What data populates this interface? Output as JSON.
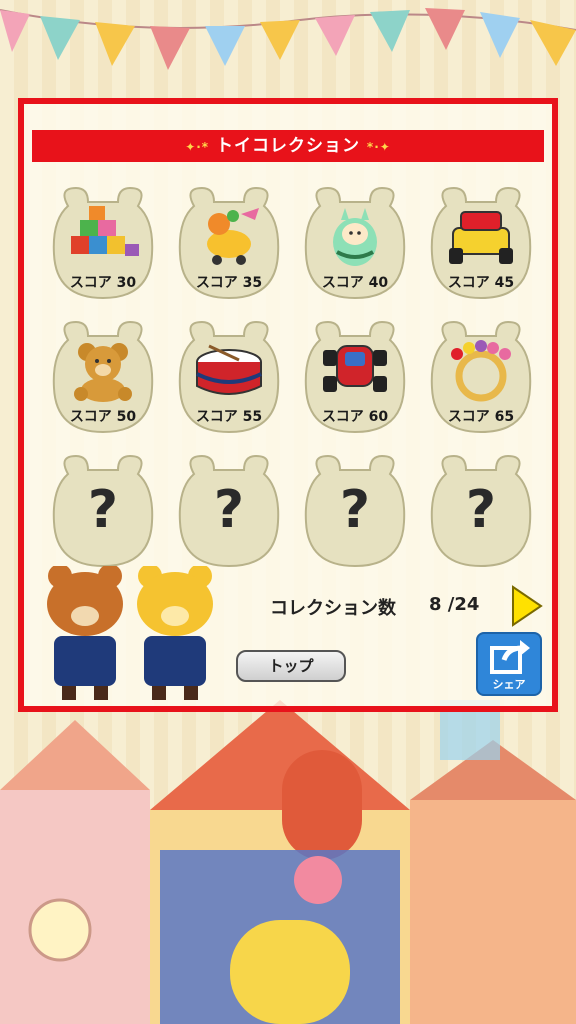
{
  "panel": {
    "title": "トイコレクション",
    "title_spark_left": "✦·*",
    "title_spark_right": "*·✦"
  },
  "toys": [
    {
      "name": "building-blocks",
      "score_label": "スコア 30",
      "unlocked": true
    },
    {
      "name": "duck-pull-toy",
      "score_label": "スコア 35",
      "unlocked": true
    },
    {
      "name": "roly-poly-doll",
      "score_label": "スコア 40",
      "unlocked": true
    },
    {
      "name": "yellow-car",
      "score_label": "スコア 45",
      "unlocked": true
    },
    {
      "name": "teddy-bear",
      "score_label": "スコア 50",
      "unlocked": true
    },
    {
      "name": "drum",
      "score_label": "スコア 55",
      "unlocked": true
    },
    {
      "name": "red-car",
      "score_label": "スコア 60",
      "unlocked": true
    },
    {
      "name": "ring-rattle",
      "score_label": "スコア 65",
      "unlocked": true
    },
    {
      "name": "locked",
      "mark": "?",
      "unlocked": false
    },
    {
      "name": "locked",
      "mark": "?",
      "unlocked": false
    },
    {
      "name": "locked",
      "mark": "?",
      "unlocked": false
    },
    {
      "name": "locked",
      "mark": "?",
      "unlocked": false
    }
  ],
  "collection": {
    "label": "コレクション数",
    "count": "8 /24"
  },
  "buttons": {
    "top": "トップ",
    "share": "シェア"
  },
  "colors": {
    "panel_border": "#e8121a",
    "share_blue": "#2f86d9",
    "arrow_yellow": "#ffe100"
  }
}
